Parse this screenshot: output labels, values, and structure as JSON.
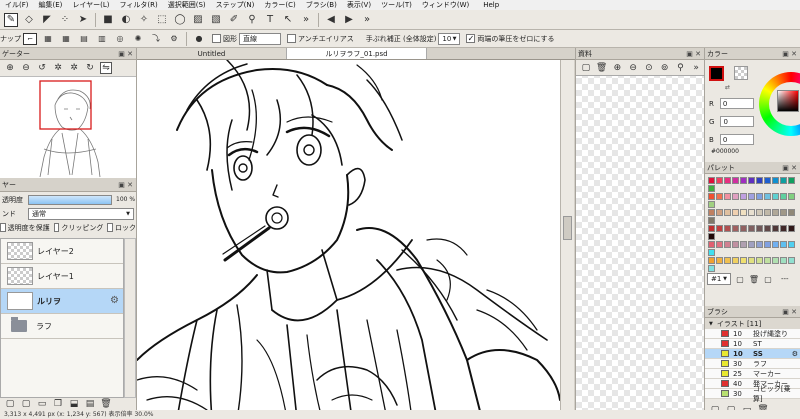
{
  "menubar": [
    "イル(F)",
    "編集(E)",
    "レイヤー(L)",
    "フィルタ(R)",
    "選択範囲(S)",
    "ステップ(N)",
    "カラー(C)",
    "ブラシ(B)",
    "表示(V)",
    "ツール(T)",
    "ウィンドウ(W)",
    "Help"
  ],
  "toolbar2": {
    "label": "ナップ",
    "shape_label": "図形",
    "shape_value": "直線",
    "antialias_label": "アンチエイリアス",
    "correction_label": "手ぶれ補正 (全体設定)",
    "correction_value": "10",
    "pressure_label": "両端の筆圧をゼロにする"
  },
  "navigator": {
    "title": "ゲーター"
  },
  "layers_panel": {
    "title": "ヤー",
    "opacity_label": "透明度",
    "opacity_value": "100 %",
    "blend_label": "ンド",
    "blend_value": "通常",
    "protect_label": "透明度を保護",
    "clipping_label": "クリッピング",
    "lock_label": "ロック",
    "layers": [
      {
        "name": "レイヤー2",
        "type": "layer",
        "active": false
      },
      {
        "name": "レイヤー1",
        "type": "layer",
        "active": false
      },
      {
        "name": "ルリヲ",
        "type": "layer",
        "active": true
      },
      {
        "name": "ラフ",
        "type": "folder",
        "active": false
      }
    ]
  },
  "tabs": [
    {
      "label": "Untitled",
      "active": false
    },
    {
      "label": "ルリヲラフ_01.psd",
      "active": true
    }
  ],
  "material": {
    "title": "資料"
  },
  "color": {
    "title": "カラー",
    "r": "0",
    "g": "0",
    "b": "0",
    "hex": "#000000",
    "r_label": "R",
    "g_label": "G",
    "b_label": "B"
  },
  "palette": {
    "title": "パレット",
    "select_value": "#1",
    "extra": "---",
    "rows": [
      [
        "#e0103a",
        "#f04060",
        "#e83080",
        "#d030a0",
        "#a030c0",
        "#6030c0",
        "#3040c0",
        "#2060d0",
        "#1090d0",
        "#10a0a0",
        "#10a060",
        "#40b040"
      ],
      [
        "#f05030",
        "#f07050",
        "#f090a0",
        "#e0a0c0",
        "#c0a0e0",
        "#a0a0e0",
        "#80a0e0",
        "#70c0e0",
        "#60d0d0",
        "#60d0a0",
        "#80d080",
        "#a0d080"
      ],
      [
        "#c08060",
        "#d0a080",
        "#e0c0a0",
        "#f0d0b0",
        "#f0e0c0",
        "#e8e0d0",
        "#d0c8b8",
        "#c0b8a8",
        "#b0a898",
        "#a09888",
        "#908878",
        "#807868"
      ],
      [
        "#c03030",
        "#c04040",
        "#b05050",
        "#a06060",
        "#906060",
        "#806060",
        "#705858",
        "#604848",
        "#503838",
        "#402828",
        "#301818",
        "#200808"
      ],
      [
        "#e06070",
        "#e07080",
        "#d08090",
        "#c090a0",
        "#b0a0b0",
        "#a0a0c0",
        "#90a0d0",
        "#80a0e0",
        "#70b0f0",
        "#60c0f0",
        "#50d0f0",
        "#40e0f0"
      ],
      [
        "#f0a030",
        "#f0b040",
        "#f0c050",
        "#f0d060",
        "#f0e070",
        "#e0e080",
        "#d0e090",
        "#c0e0a0",
        "#b0e0b0",
        "#a0e0c0",
        "#90e0d0",
        "#80e0e0"
      ]
    ]
  },
  "brushes": {
    "title": "ブラシ",
    "group": "イラスト [11]",
    "items": [
      {
        "size": "10",
        "name": "投げ縄塗り",
        "color": "#e03030",
        "active": false
      },
      {
        "size": "10",
        "name": "ST",
        "color": "#e03030",
        "active": false
      },
      {
        "size": "10",
        "name": "SS",
        "color": "#e8e830",
        "active": true
      },
      {
        "size": "30",
        "name": "ラフ",
        "color": "#e8e830",
        "active": false
      },
      {
        "size": "25",
        "name": "マーカー",
        "color": "#e8e830",
        "active": false
      },
      {
        "size": "40",
        "name": "発マーカー",
        "color": "#e03030",
        "active": false
      },
      {
        "size": "30",
        "name": "コピック[乗算]",
        "color": "#b8e070",
        "active": false
      }
    ]
  },
  "icons": {
    "toolbar1": [
      "pen-tool-icon",
      "eraser-icon",
      "fill-bucket-icon",
      "dots-icon",
      "move-icon",
      "black-square-icon",
      "blur-icon",
      "magic-select-icon",
      "rect-select-icon",
      "lasso-icon",
      "fill-select-icon",
      "brush-select-icon",
      "select-pen-icon",
      "eyedropper-icon",
      "text-icon",
      "pointer-icon",
      "more-icon",
      "step-back-icon",
      "step-forward-icon",
      "more-icon"
    ]
  },
  "statusbar": "3,313 x 4,491 px  (x: 1,234  y: 567)  表示倍率 30.0%"
}
